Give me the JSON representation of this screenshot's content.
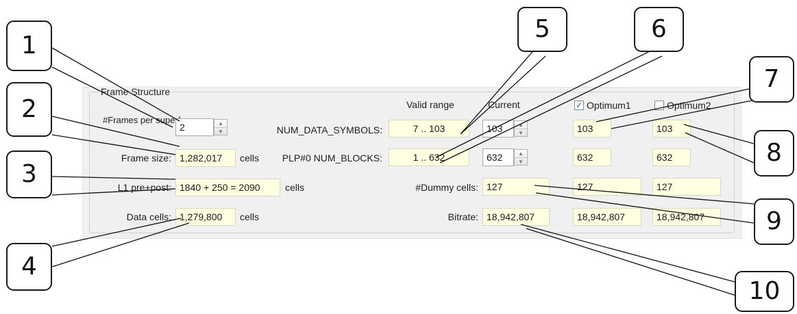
{
  "group_title": "Frame Structure",
  "col_headers": {
    "valid_range": "Valid range",
    "current": "Current",
    "optimum1": "Optimum1",
    "optimum2": "Optimum2"
  },
  "optimum1_checked": true,
  "optimum2_checked": false,
  "left": {
    "frames_label": "#Frames per superframe:",
    "frames_value": "2",
    "frame_size_label": "Frame size:",
    "frame_size_value": "1,282,017",
    "frame_size_unit": "cells",
    "l1_label": "L1 pre+post:",
    "l1_value": "1840 + 250 = 2090",
    "l1_unit": "cells",
    "data_cells_label": "Data cells:",
    "data_cells_value": "1,279,800",
    "data_cells_unit": "cells"
  },
  "rows": {
    "num_data_symbols": {
      "label": "NUM_DATA_SYMBOLS:",
      "range": "7 .. 103",
      "current": "103",
      "opt1": "103",
      "opt2": "103"
    },
    "plp_num_blocks": {
      "label": "PLP#0 NUM_BLOCKS:",
      "range": "1 .. 632",
      "current": "632",
      "opt1": "632",
      "opt2": "632"
    },
    "dummy_cells": {
      "label": "#Dummy cells:",
      "current": "127",
      "opt1": "127",
      "opt2": "127"
    },
    "bitrate": {
      "label": "Bitrate:",
      "current": "18,942,807",
      "opt1": "18,942,807",
      "opt2": "18,942,807"
    }
  },
  "callouts": [
    "1",
    "2",
    "3",
    "4",
    "5",
    "6",
    "7",
    "8",
    "9",
    "10"
  ],
  "checkmark_glyph": "✓",
  "spin_up_glyph": "▲",
  "spin_down_glyph": "▼"
}
